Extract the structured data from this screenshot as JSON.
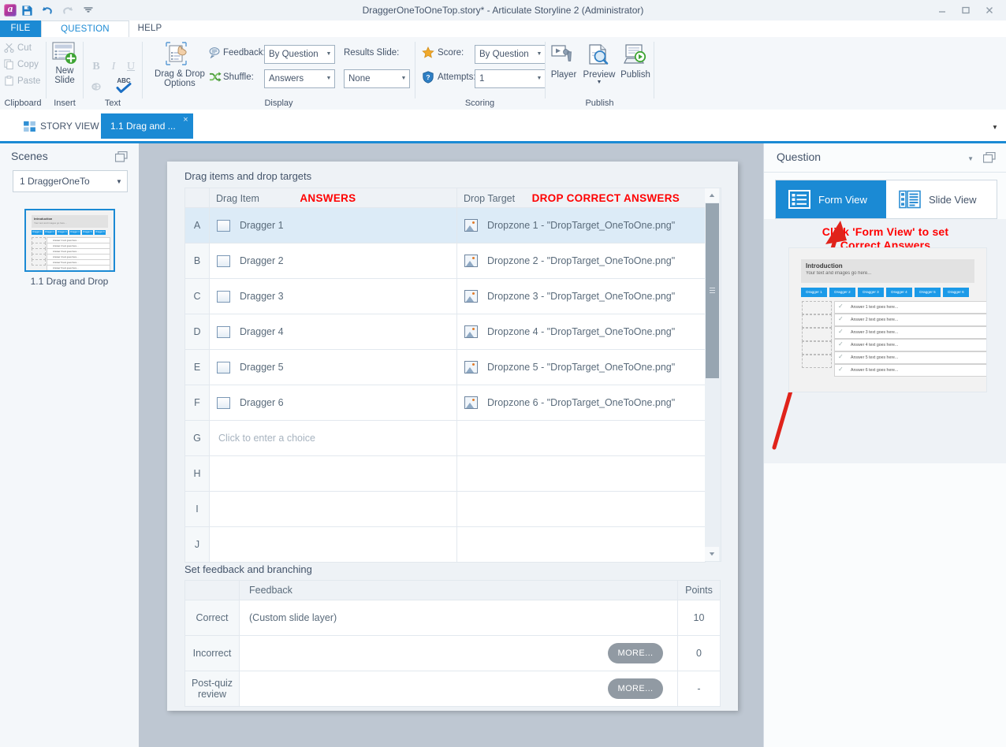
{
  "window": {
    "title": "DraggerOneToOneTop.story*  -  Articulate Storyline 2 (Administrator)",
    "quick_access": [
      "app-logo",
      "save-icon",
      "undo-icon",
      "redo-icon",
      "customize-qat-icon"
    ],
    "controls": [
      "minimize",
      "maximize",
      "close"
    ],
    "help_icon": "help-icon"
  },
  "ribbon": {
    "tabs": [
      {
        "label": "FILE",
        "active": false
      },
      {
        "label": "QUESTION",
        "active": true
      },
      {
        "label": "HELP",
        "active": false
      }
    ],
    "groups": {
      "clipboard": {
        "label": "Clipboard",
        "items": [
          {
            "label": "Cut",
            "icon": "scissors-icon"
          },
          {
            "label": "Copy",
            "icon": "copy-icon"
          },
          {
            "label": "Paste",
            "icon": "paste-icon"
          }
        ]
      },
      "insert": {
        "label": "Insert",
        "new_slide": "New\nSlide",
        "new_slide_line1": "New",
        "new_slide_line2": "Slide"
      },
      "text": {
        "label": "Text",
        "bold": "B",
        "italic": "I",
        "underline": "U",
        "link": "link-icon",
        "spelling": "ABC"
      },
      "display": {
        "label": "Display",
        "dnd_options_line1": "Drag & Drop",
        "dnd_options_line2": "Options",
        "feedback_label": "Feedback:",
        "feedback_value": "By Question",
        "shuffle_label": "Shuffle:",
        "shuffle_value": "Answers",
        "results_slide_label": "Results Slide:",
        "results_slide_value": "None"
      },
      "scoring": {
        "label": "Scoring",
        "score_label": "Score:",
        "score_value": "By Question",
        "attempts_label": "Attempts:",
        "attempts_value": "1"
      },
      "publish": {
        "label": "Publish",
        "buttons": [
          {
            "label": "Player",
            "icon": "player-icon"
          },
          {
            "label": "Preview",
            "icon": "preview-icon"
          },
          {
            "label": "Publish",
            "icon": "publish-icon"
          }
        ]
      }
    }
  },
  "doc_tabs": {
    "story_view": "STORY VIEW",
    "active_tab": "1.1 Drag and ...",
    "close_glyph": "×"
  },
  "sidebar": {
    "title": "Scenes",
    "scene_selector": "1 DraggerOneTo",
    "thumbnail_label": "1.1 Drag and Drop"
  },
  "form": {
    "section1_label": "Drag items and drop targets",
    "section2_label": "Set feedback and branching",
    "grid_headers": {
      "drag_item": "Drag Item",
      "drag_item_annotation": "ANSWERS",
      "drop_target": "Drop Target",
      "drop_target_annotation": "DROP CORRECT ANSWERS"
    },
    "rows": [
      {
        "letter": "A",
        "drag_item": "Dragger 1",
        "drop_target": "Dropzone 1 - \"DropTarget_OneToOne.png\"",
        "selected": true,
        "has_item": true
      },
      {
        "letter": "B",
        "drag_item": "Dragger 2",
        "drop_target": "Dropzone 2 - \"DropTarget_OneToOne.png\"",
        "selected": false,
        "has_item": true
      },
      {
        "letter": "C",
        "drag_item": "Dragger 3",
        "drop_target": "Dropzone 3 - \"DropTarget_OneToOne.png\"",
        "selected": false,
        "has_item": true
      },
      {
        "letter": "D",
        "drag_item": "Dragger 4",
        "drop_target": "Dropzone 4 - \"DropTarget_OneToOne.png\"",
        "selected": false,
        "has_item": true
      },
      {
        "letter": "E",
        "drag_item": "Dragger 5",
        "drop_target": "Dropzone 5 - \"DropTarget_OneToOne.png\"",
        "selected": false,
        "has_item": true
      },
      {
        "letter": "F",
        "drag_item": "Dragger 6",
        "drop_target": "Dropzone 6 - \"DropTarget_OneToOne.png\"",
        "selected": false,
        "has_item": true
      },
      {
        "letter": "G",
        "drag_item": "Click to enter a choice",
        "drop_target": "",
        "selected": false,
        "has_item": false,
        "placeholder": true
      },
      {
        "letter": "H",
        "drag_item": "",
        "drop_target": "",
        "selected": false,
        "has_item": false
      },
      {
        "letter": "I",
        "drag_item": "",
        "drop_target": "",
        "selected": false,
        "has_item": false
      },
      {
        "letter": "J",
        "drag_item": "",
        "drop_target": "",
        "selected": false,
        "has_item": false
      }
    ],
    "feedback_headers": {
      "feedback": "Feedback",
      "points": "Points"
    },
    "feedback_rows": [
      {
        "label": "Correct",
        "text": "(Custom slide layer)",
        "more": "",
        "points": "10"
      },
      {
        "label": "Incorrect",
        "text": "",
        "more": "MORE...",
        "points": "0"
      },
      {
        "label": "Post-quiz review",
        "label_line1": "Post-quiz",
        "label_line2": "review",
        "text": "",
        "more": "MORE...",
        "points": "-"
      }
    ]
  },
  "right_panel": {
    "title": "Question",
    "view_tabs": [
      {
        "label": "Form View",
        "icon": "form-view-icon",
        "active": true
      },
      {
        "label": "Slide View",
        "icon": "slide-view-icon",
        "active": false
      }
    ],
    "annotation_line1": "Click 'Form View' to set",
    "annotation_line2": "Correct Answers",
    "slide_preview": {
      "title": "Introduction",
      "subtitle": "Your text and images go here...",
      "chips": [
        "Dragger 1",
        "Dragger 2",
        "Dragger 3",
        "Dragger 4",
        "Dragger 5",
        "Dragger 6"
      ],
      "answers": [
        "Answer 1 text goes here...",
        "Answer 2 text goes here...",
        "Answer 3 text goes here...",
        "Answer 4 text goes here...",
        "Answer 5 text goes here...",
        "Answer 6 text goes here..."
      ]
    }
  },
  "colors": {
    "accent": "#1b8ad4",
    "annotation_red": "#ff0000",
    "chrome": "#eff3f7",
    "ribbon": "#f4f7fa",
    "workarea": "#bec7d2",
    "row_selected": "#dcebf7"
  }
}
